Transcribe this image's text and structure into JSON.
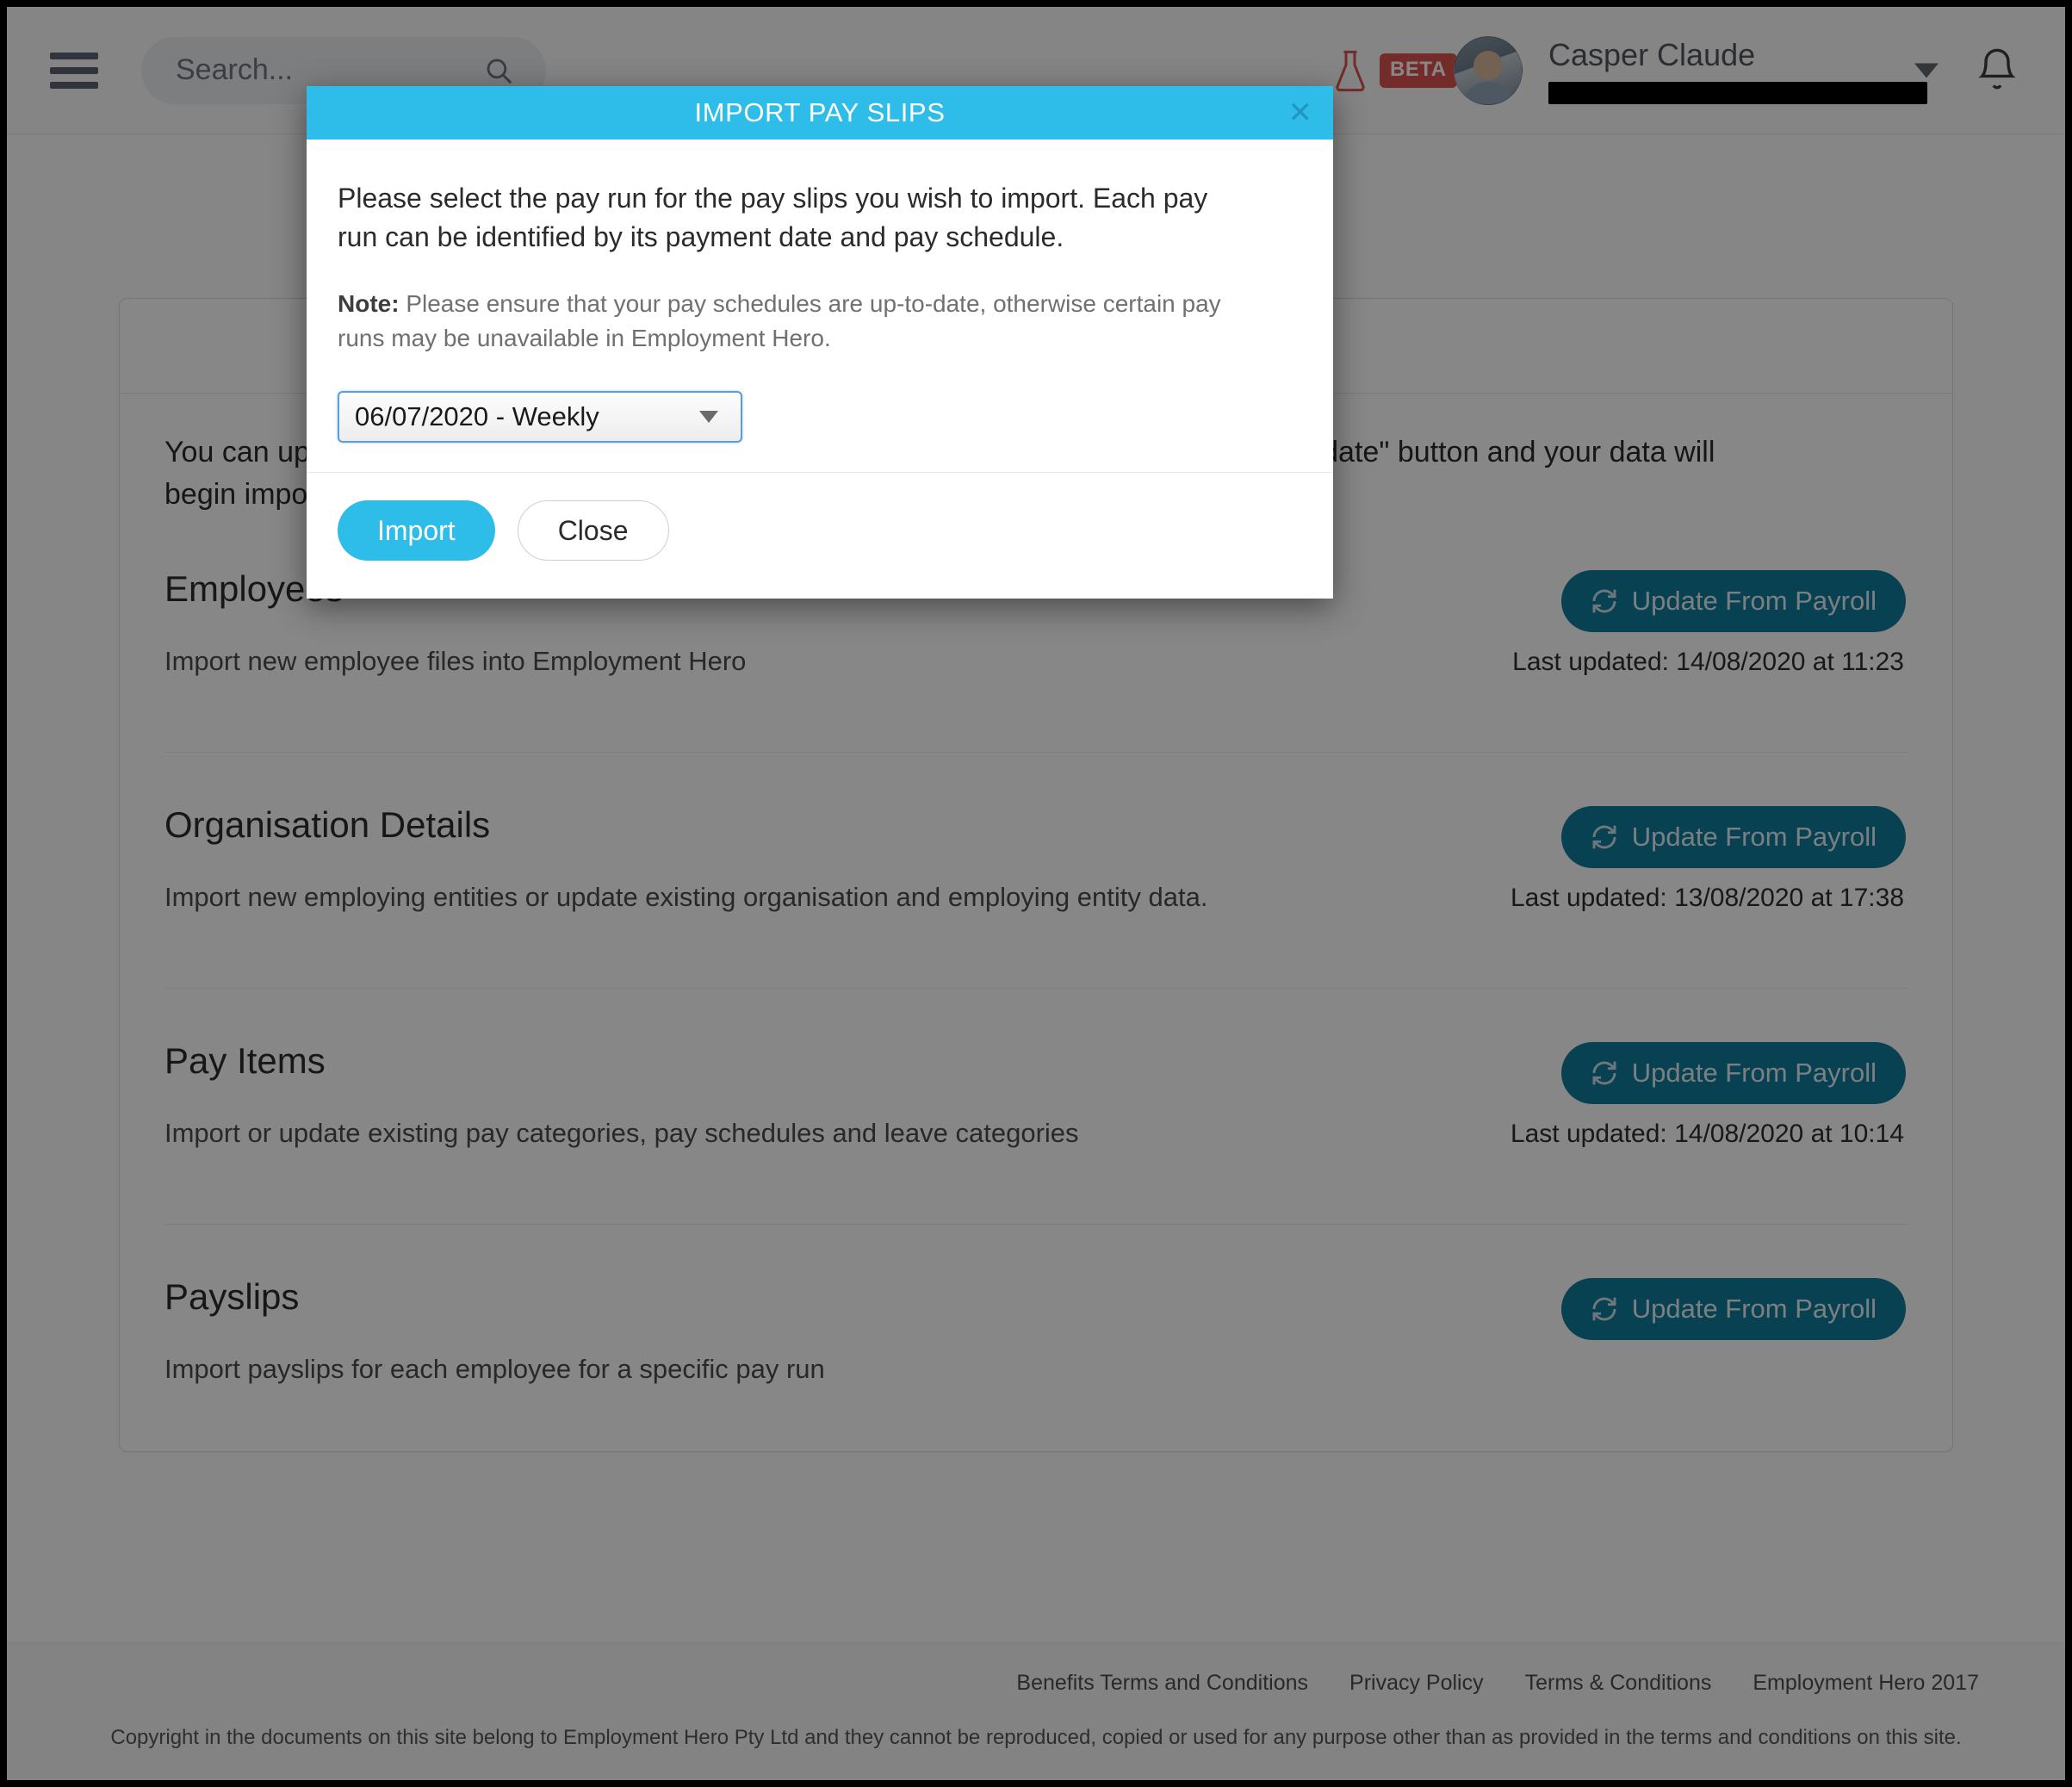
{
  "header": {
    "menu_icon": "hamburger-icon",
    "search_placeholder": "Search...",
    "search_icon": "search-icon",
    "beta_badge": "BETA",
    "flask_icon": "flask-icon",
    "user_name": "Casper Claude",
    "user_email_redacted": "",
    "bell_icon": "notification-bell-icon",
    "caret_icon": "chevron-down-icon"
  },
  "main": {
    "intro_left": "You can updat",
    "intro_right": "ly click on the \"Update\" button and your data will",
    "intro_line2": "begin importin",
    "sections": [
      {
        "title": "Employees",
        "description": "Import new employee files into Employment Hero",
        "button": "Update From Payroll",
        "last_updated": "Last updated: 14/08/2020 at 11:23"
      },
      {
        "title": "Organisation Details",
        "description": "Import new employing entities or update existing organisation and employing entity data.",
        "button": "Update From Payroll",
        "last_updated": "Last updated: 13/08/2020 at 17:38"
      },
      {
        "title": "Pay Items",
        "description": "Import or update existing pay categories, pay schedules and leave categories",
        "button": "Update From Payroll",
        "last_updated": "Last updated: 14/08/2020 at 10:14"
      },
      {
        "title": "Payslips",
        "description": "Import payslips for each employee for a specific pay run",
        "button": "Update From Payroll",
        "last_updated": ""
      }
    ]
  },
  "footer": {
    "links": [
      "Benefits Terms and Conditions",
      "Privacy Policy",
      "Terms & Conditions",
      "Employment Hero 2017"
    ],
    "copyright": "Copyright in the documents on this site belong to Employment Hero Pty Ltd and they cannot be reproduced, copied or used for any purpose other than as provided in the terms and conditions on this site."
  },
  "modal": {
    "title": "IMPORT PAY SLIPS",
    "close_icon": "close-icon",
    "lead": "Please select the pay run for the pay slips you wish to import. Each pay run can be identified by its payment date and pay schedule.",
    "note_label": "Note:",
    "note_text": "Please ensure that your pay schedules are up-to-date, otherwise certain pay runs may be unavailable in Employment Hero.",
    "select_value": "06/07/2020 - Weekly",
    "select_arrow_icon": "chevron-down-icon",
    "import_label": "Import",
    "close_label": "Close"
  },
  "colors": {
    "modal_header": "#2dbde8",
    "import_button": "#2dbde8",
    "update_button": "#0f7b9c",
    "beta_badge": "#d9534f",
    "select_focus_border": "#5b9dd9"
  }
}
